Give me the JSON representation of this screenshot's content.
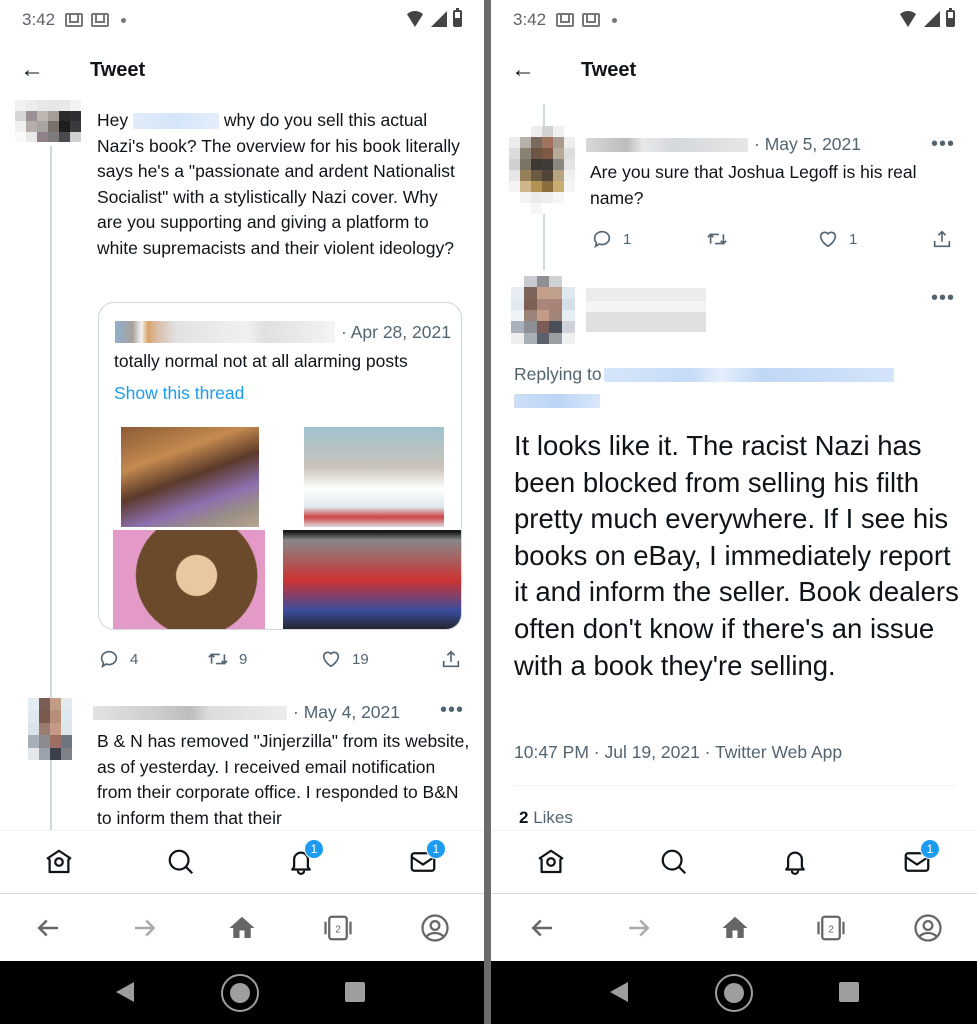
{
  "status_bar": {
    "time": "3:42"
  },
  "left_screen": {
    "header": {
      "title": "Tweet"
    },
    "main_tweet": {
      "text_prefix": "Hey",
      "text": "why do you sell this actual Nazi's book? The overview for his book literally says he's a \"passionate and ardent Nationalist Socialist\" with a stylistically Nazi cover. Why are you supporting and giving a platform to white supremacists and their violent ideology?",
      "quote": {
        "date": "· Apr 28, 2021",
        "text": "totally normal not at all alarming posts",
        "link": "Show this thread",
        "media": [
          "cartoon-image-1",
          "comic-image-2",
          "cartoon-image-3",
          "illustration-image-4"
        ]
      },
      "actions": {
        "replies": "4",
        "retweets": "9",
        "likes": "19"
      }
    },
    "reply_tweet": {
      "date": "· May 4, 2021",
      "text": "B & N has removed \"Jinjerzilla\" from its website, as of yesterday.  I received email notification from their corporate office.  I responded to B&N to inform them that their"
    },
    "bottom_nav": {
      "notifications_badge": "1",
      "messages_badge": "1"
    },
    "browser_bar": {
      "tabs_count": "2"
    }
  },
  "right_screen": {
    "header": {
      "title": "Tweet"
    },
    "parent_tweet": {
      "date": "· May 5, 2021",
      "text": "Are you sure that Joshua Legoff is his real name?",
      "actions": {
        "replies": "1",
        "retweets": "",
        "likes": "1"
      }
    },
    "focused_tweet": {
      "replying_to_label": "Replying to",
      "text": "It looks like it.  The racist Nazi has been blocked from selling his filth pretty much everywhere.  If I see his books on eBay, I immediately report it and inform the seller.  Book dealers often don't know if there's an issue with a book they're selling.",
      "timestamp": "10:47 PM · Jul 19, 2021 · Twitter Web App",
      "likes_count": "2",
      "likes_label": "Likes"
    },
    "bottom_nav": {
      "messages_badge": "1"
    },
    "browser_bar": {
      "tabs_count": "2"
    }
  },
  "colors": {
    "accent": "#1d9bf0",
    "text": "#0f1419",
    "muted": "#536471",
    "divider": "#6b6b6b"
  }
}
